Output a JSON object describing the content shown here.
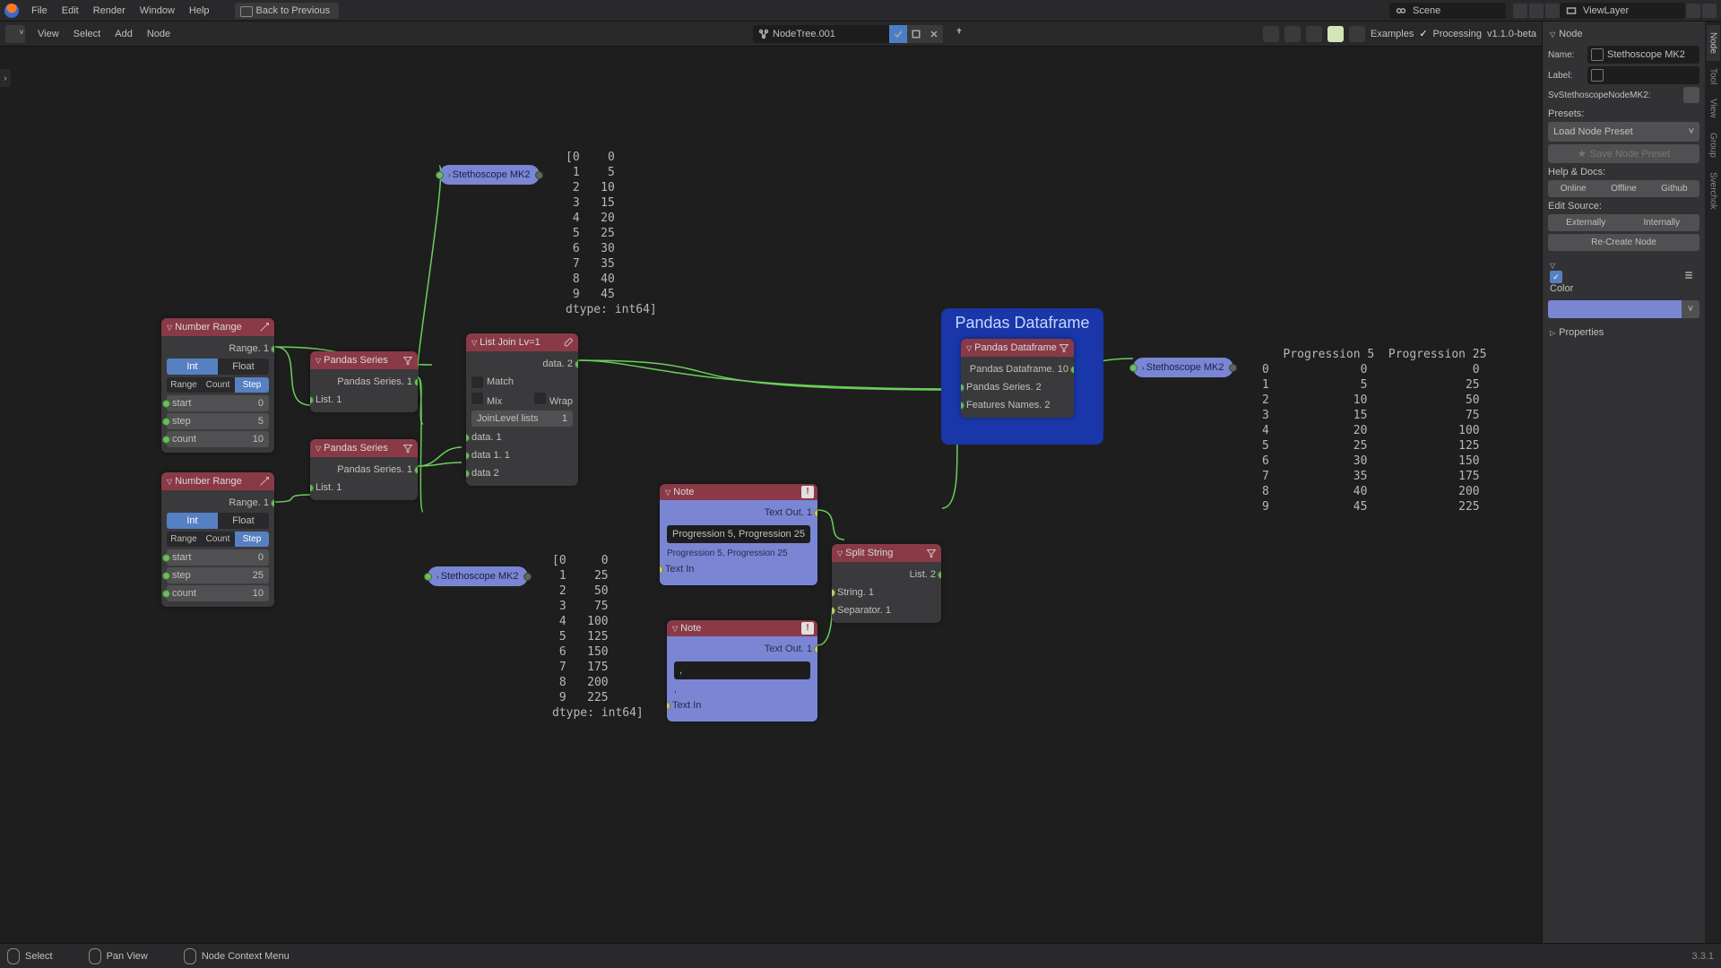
{
  "top_menu": {
    "items": [
      "File",
      "Edit",
      "Render",
      "Window",
      "Help"
    ],
    "back": "Back to Previous",
    "scene": "Scene",
    "view_layer": "ViewLayer"
  },
  "toolbar2": {
    "items": [
      "View",
      "Select",
      "Add",
      "Node"
    ],
    "tree": "NodeTree.001",
    "examples": "Examples",
    "processing": "Processing",
    "version": "v1.1.0-beta"
  },
  "nodes": {
    "number_range1": {
      "title": "Number Range",
      "range_out": "Range. 1",
      "int": "Int",
      "float": "Float",
      "range": "Range",
      "count": "Count",
      "step": "Step",
      "start_lbl": "start",
      "start_val": "0",
      "step_lbl": "step",
      "step_val": "5",
      "count_lbl": "count",
      "count_val": "10"
    },
    "number_range2": {
      "title": "Number Range",
      "range_out": "Range. 1",
      "int": "Int",
      "float": "Float",
      "range": "Range",
      "count": "Count",
      "step": "Step",
      "start_lbl": "start",
      "start_val": "0",
      "step_lbl": "step",
      "step_val": "25",
      "count_lbl": "count",
      "count_val": "10"
    },
    "pandas_series1": {
      "title": "Pandas Series",
      "out": "Pandas Series. 1",
      "in": "List. 1"
    },
    "pandas_series2": {
      "title": "Pandas Series",
      "out": "Pandas Series. 1",
      "in": "List. 1"
    },
    "list_join": {
      "title": "List Join Lv=1",
      "out": "data. 2",
      "match": "Match",
      "mix": "Mix",
      "wrap": "Wrap",
      "joinlevel_lbl": "JoinLevel lists",
      "joinlevel_val": "1",
      "in1": "data. 1",
      "in2": "data 1. 1",
      "in3": "data 2"
    },
    "stetho1": "Stethoscope MK2",
    "stetho2": "Stethoscope MK2",
    "stetho3": "Stethoscope MK2",
    "frame_title": "Pandas Dataframe",
    "pandas_df": {
      "title": "Pandas Dataframe",
      "out": "Pandas Dataframe. 10",
      "in1": "Pandas Series. 2",
      "in2": "Features Names. 2"
    },
    "note1": {
      "title": "Note",
      "out": "Text Out. 1",
      "input": "Progression 5, Progression 25",
      "preview": "Progression 5, Progression 25",
      "in": "Text In"
    },
    "note2": {
      "title": "Note",
      "out": "Text Out. 1",
      "input": ",",
      "preview": ",",
      "in": "Text In"
    },
    "split": {
      "title": "Split String",
      "out": "List. 2",
      "in1": "String. 1",
      "in2": "Separator. 1"
    }
  },
  "canvas_text1": "[0    0\n 1    5\n 2   10\n 3   15\n 4   20\n 5   25\n 6   30\n 7   35\n 8   40\n 9   45\ndtype: int64]",
  "canvas_text2": "[0     0\n 1    25\n 2    50\n 3    75\n 4   100\n 5   125\n 6   150\n 7   175\n 8   200\n 9   225\ndtype: int64]",
  "chart_data": {
    "type": "table",
    "title": "",
    "columns": [
      "",
      "Progression 5",
      "Progression 25"
    ],
    "rows": [
      [
        "0",
        "0",
        "0"
      ],
      [
        "1",
        "5",
        "25"
      ],
      [
        "2",
        "10",
        "50"
      ],
      [
        "3",
        "15",
        "75"
      ],
      [
        "4",
        "20",
        "100"
      ],
      [
        "5",
        "25",
        "125"
      ],
      [
        "6",
        "30",
        "150"
      ],
      [
        "7",
        "35",
        "175"
      ],
      [
        "8",
        "40",
        "200"
      ],
      [
        "9",
        "45",
        "225"
      ]
    ]
  },
  "sidebar": {
    "tabs": [
      "Node",
      "Tool",
      "View",
      "Group",
      "Sverchok"
    ],
    "node": "Node",
    "name_lbl": "Name:",
    "name_val": "Stethoscope MK2",
    "label_lbl": "Label:",
    "label_val": "",
    "type_id": "SvStethoscopeNodeMK2:",
    "presets": "Presets:",
    "load_preset": "Load Node Preset",
    "save_preset": "Save Node Preset",
    "help": "Help & Docs:",
    "online": "Online",
    "offline": "Offline",
    "github": "Github",
    "edit_source": "Edit Source:",
    "externally": "Externally",
    "internally": "Internally",
    "recreate": "Re-Create Node",
    "color": "Color",
    "properties": "Properties"
  },
  "statusbar": {
    "select": "Select",
    "pan": "Pan View",
    "context": "Node Context Menu",
    "version": "3.3.1"
  }
}
